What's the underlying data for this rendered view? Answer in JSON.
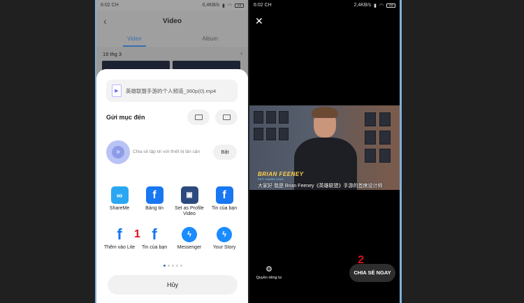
{
  "left_phone": {
    "status": {
      "time": "6:02 CH",
      "speed": "0,4KB/s",
      "battery": "29"
    },
    "header": {
      "title": "Video"
    },
    "tabs": [
      "Video",
      "Album"
    ],
    "date_group": "19 thg 3",
    "share_sheet": {
      "file_name": "英雄联盟手游的个人频道_360p(0).mp4",
      "send_to_title": "Gửi mục đến",
      "nearby_text": "Chia sẻ tập tin với thiết bị lân cận",
      "nearby_button": "Bật",
      "apps": [
        {
          "label": "ShareMe",
          "icon": "shareme-icon",
          "glyph": "∞"
        },
        {
          "label": "Bảng tin",
          "icon": "facebook-icon",
          "glyph": "f"
        },
        {
          "label": "Set as Profile Video",
          "icon": "facebook-profile-icon",
          "glyph": "▣"
        },
        {
          "label": "Tin của bạn",
          "icon": "facebook-icon",
          "glyph": "f"
        },
        {
          "label": "Thêm vào Lite",
          "icon": "facebook-lite-icon",
          "glyph": "f"
        },
        {
          "label": "Tin của bạn",
          "icon": "facebook-icon",
          "glyph": "f"
        },
        {
          "label": "Messenger",
          "icon": "messenger-icon",
          "glyph": "ϟ"
        },
        {
          "label": "Your Story",
          "icon": "messenger-icon",
          "glyph": "ϟ"
        }
      ],
      "step_marker_1": "1",
      "cancel": "Hủy"
    }
  },
  "right_phone": {
    "status": {
      "time": "6:02 CH",
      "speed": "2,4KB/s",
      "battery": "29"
    },
    "video": {
      "name_overlay": "BRIAN FEENEY",
      "name_sub": "RIOT GAMES LEAD",
      "subtitle": "大家好 我是 Brian Feeney《英雄联盟》手游的首席设计师"
    },
    "privacy_label": "Quyền riêng tư",
    "share_now": "CHIA SẺ NGAY",
    "step_marker_2": "2"
  },
  "colors": {
    "accent": "#3a6fb0",
    "facebook": "#1877f2",
    "marker": "#d7141a"
  }
}
